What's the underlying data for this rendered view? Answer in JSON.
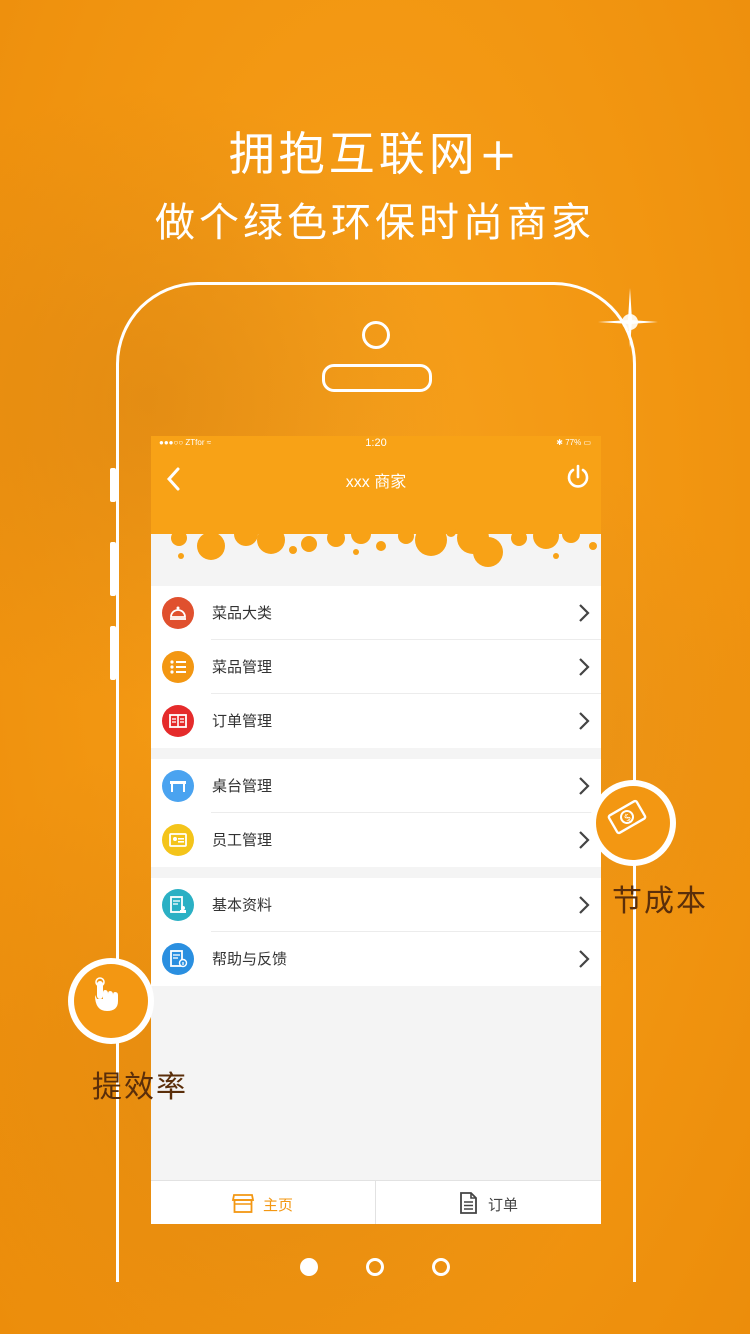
{
  "headline": {
    "line1": "拥抱互联网+",
    "line2": "做个绿色环保时尚商家"
  },
  "status_bar": {
    "carrier": "●●●○○ ZTfor ≈",
    "time": "1:20",
    "battery": "✱ 77% ▭"
  },
  "nav": {
    "title": "xxx 商家",
    "back_icon": "chevron-left-icon",
    "power_icon": "power-icon"
  },
  "menu_groups": [
    [
      {
        "label": "菜品大类",
        "icon": "dish-cover-icon",
        "color": "#e0502e"
      },
      {
        "label": "菜品管理",
        "icon": "list-icon",
        "color": "#f39712"
      },
      {
        "label": "订单管理",
        "icon": "book-icon",
        "color": "#e52b2b"
      }
    ],
    [
      {
        "label": "桌台管理",
        "icon": "table-icon",
        "color": "#4aa3f0"
      },
      {
        "label": "员工管理",
        "icon": "id-card-icon",
        "color": "#f4c41a"
      }
    ],
    [
      {
        "label": "基本资料",
        "icon": "profile-doc-icon",
        "color": "#2bb0c4"
      },
      {
        "label": "帮助与反馈",
        "icon": "help-doc-icon",
        "color": "#2a8fe0"
      }
    ]
  ],
  "tabs": [
    {
      "label": "主页",
      "icon": "shop-icon",
      "active": true,
      "color": "#f39712"
    },
    {
      "label": "订单",
      "icon": "document-icon",
      "active": false,
      "color": "#444444"
    }
  ],
  "badges": {
    "save_cost": {
      "label": "节成本",
      "icon": "money-bill-icon"
    },
    "efficiency": {
      "label": "提效率",
      "icon": "tap-hand-icon"
    }
  },
  "pagination": {
    "count": 3,
    "current": 1
  },
  "colors": {
    "brand": "#f39712",
    "nav": "#f8a216"
  }
}
